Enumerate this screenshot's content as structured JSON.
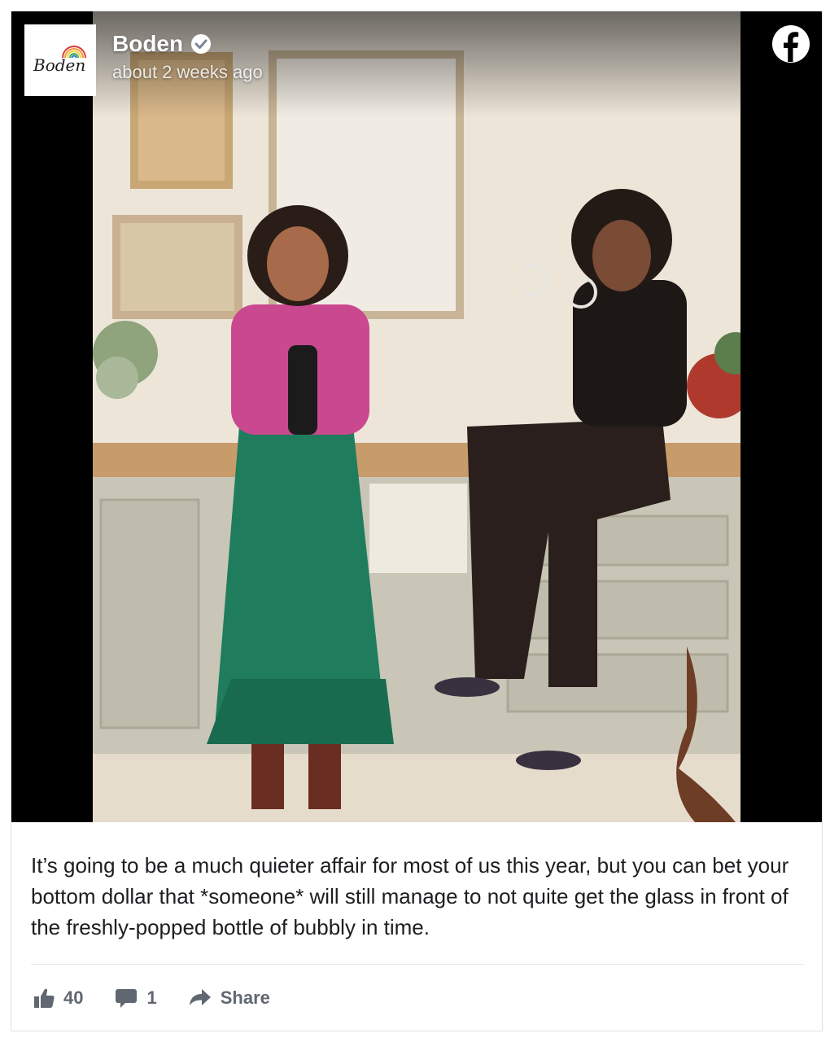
{
  "post": {
    "page_name": "Boden",
    "avatar_logo_text": "Boden",
    "timestamp": "about 2 weeks ago",
    "text": "It’s going to be a much quieter affair for most of us this year, but you can bet your bottom dollar that *someone* will still manage to not quite get the glass in front of the freshly-popped bottle of bubbly in time."
  },
  "icons": {
    "verified": "verified-badge-icon",
    "platform": "facebook-logo-icon",
    "like": "thumbs-up-icon",
    "comment": "comment-bubble-icon",
    "share": "share-arrow-icon"
  },
  "actions": {
    "likes": "40",
    "comments": "1",
    "share_label": "Share"
  },
  "colors": {
    "text": "#1c1e21",
    "muted": "#606770",
    "facebook_logo": "#ffffff"
  }
}
